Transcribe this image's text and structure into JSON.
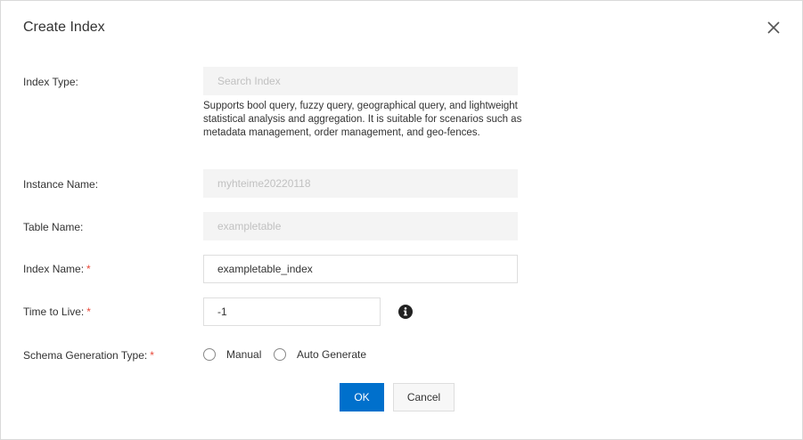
{
  "dialog": {
    "title": "Create Index",
    "close_icon": "close-icon"
  },
  "form": {
    "index_type": {
      "label": "Index Type:",
      "value": "Search Index",
      "help": "Supports bool query, fuzzy query, geographical query, and lightweight statistical analysis and aggregation. It is suitable for scenarios such as metadata management, order management, and geo-fences."
    },
    "instance_name": {
      "label": "Instance Name:",
      "value": "myhteime20220118"
    },
    "table_name": {
      "label": "Table Name:",
      "value": "exampletable"
    },
    "index_name": {
      "label": "Index Name:",
      "required": "*",
      "value": "exampletable_index"
    },
    "time_to_live": {
      "label": "Time to Live:",
      "required": "*",
      "value": "-1",
      "info_icon": "info-icon"
    },
    "schema_generation_type": {
      "label": "Schema Generation Type:",
      "required": "*",
      "options": [
        "Manual",
        "Auto Generate"
      ]
    }
  },
  "footer": {
    "ok_label": "OK",
    "cancel_label": "Cancel"
  },
  "colors": {
    "primary": "#0070cc",
    "required": "#e84738",
    "disabled_bg": "#f4f4f4",
    "disabled_text": "#c1c1c1"
  }
}
